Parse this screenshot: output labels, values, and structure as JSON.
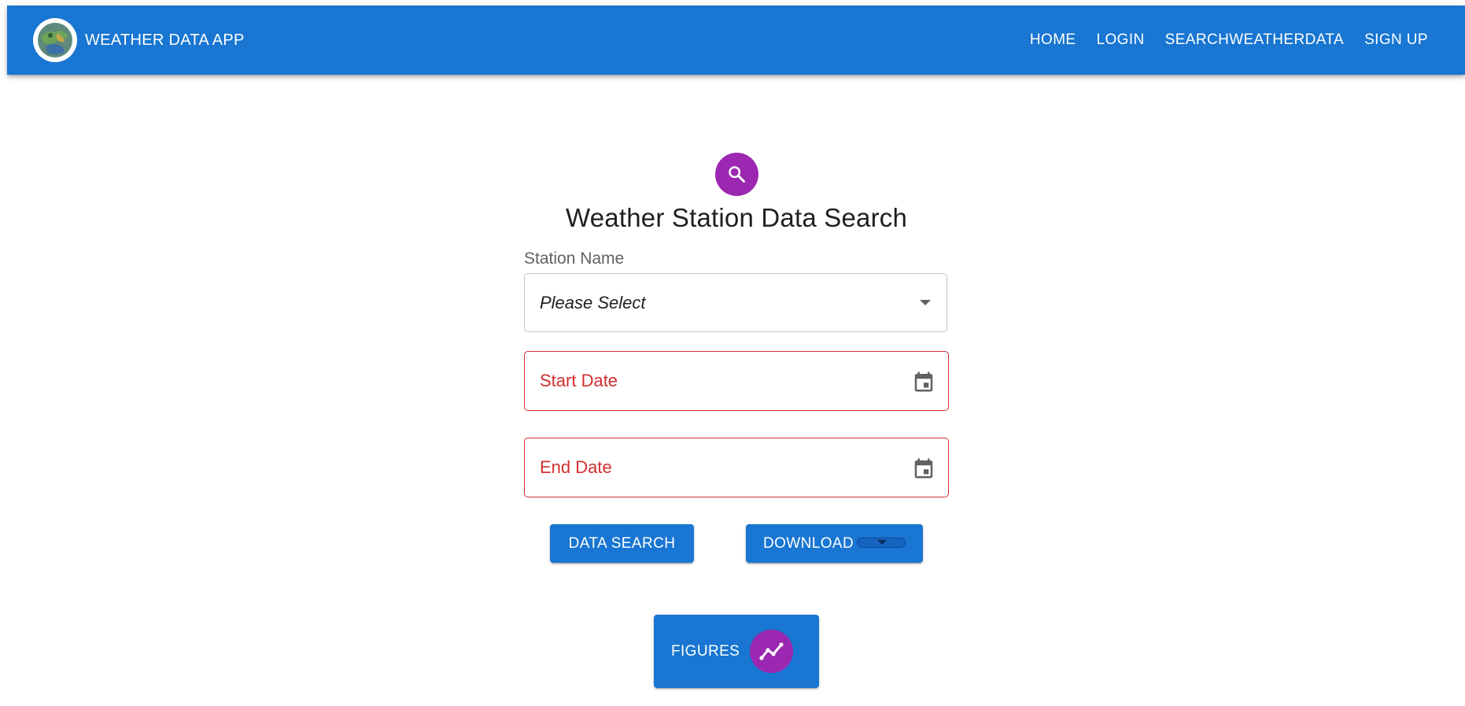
{
  "header": {
    "brand": "WEATHER DATA APP",
    "logo_icon": "weather-globe-logo",
    "background": "#1976d2",
    "nav": [
      {
        "label": "HOME"
      },
      {
        "label": "LOGIN"
      },
      {
        "label": "SEARCHWEATHERDATA"
      },
      {
        "label": "SIGN UP"
      }
    ]
  },
  "form": {
    "icon": "search-icon",
    "icon_color": "#9c27b0",
    "title": "Weather Station Data Search",
    "station": {
      "label": "Station Name",
      "value": "Please Select"
    },
    "start_date": {
      "placeholder": "Start Date",
      "icon": "calendar-icon",
      "error_color": "#d32f2f"
    },
    "end_date": {
      "placeholder": "End Date",
      "icon": "calendar-icon",
      "error_color": "#d32f2f"
    },
    "buttons": {
      "search": "DATA SEARCH",
      "download": "DOWNLOAD",
      "figures": "FIGURES",
      "figures_icon": "line-chart-icon"
    }
  }
}
